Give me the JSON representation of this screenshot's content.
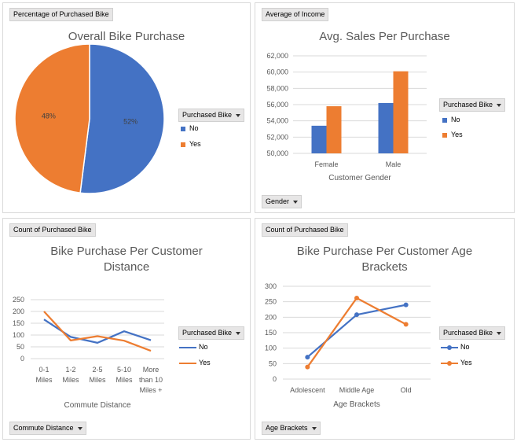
{
  "colors": {
    "no": "#4472c4",
    "yes": "#ed7d31",
    "grid": "#d9d9d9",
    "axis": "#bfbfbf",
    "text": "#595959"
  },
  "legend": {
    "header": "Purchased Bike",
    "no": "No",
    "yes": "Yes"
  },
  "panels": [
    {
      "field_button": "Percentage of Purchased Bike",
      "axis_button": ""
    },
    {
      "field_button": "Average of Income",
      "axis_button": "Gender"
    },
    {
      "field_button": "Count of Purchased Bike",
      "axis_button": "Commute Distance"
    },
    {
      "field_button": "Count of Purchased Bike",
      "axis_button": "Age Brackets"
    }
  ],
  "chart_data": [
    {
      "type": "pie",
      "title": "Overall Bike Purchase",
      "slices": [
        {
          "name": "No",
          "value": 52,
          "label": "52%"
        },
        {
          "name": "Yes",
          "value": 48,
          "label": "48%"
        }
      ],
      "legend": "right"
    },
    {
      "type": "bar",
      "title": "Avg. Sales Per Purchase",
      "xlabel": "Customer Gender",
      "categories": [
        "Female",
        "Male"
      ],
      "series": [
        {
          "name": "No",
          "values": [
            53400,
            56200
          ]
        },
        {
          "name": "Yes",
          "values": [
            55800,
            60100
          ]
        }
      ],
      "ylim": [
        50000,
        62000
      ],
      "yticks": [
        "50,000",
        "52,000",
        "54,000",
        "56,000",
        "58,000",
        "60,000",
        "62,000"
      ],
      "grid": true,
      "legend": "right"
    },
    {
      "type": "line",
      "title_lines": [
        "Bike Purchase Per Customer",
        "Distance"
      ],
      "xlabel": "Commute Distance",
      "categories": [
        [
          "0-1",
          "Miles"
        ],
        [
          "1-2",
          "Miles"
        ],
        [
          "2-5",
          "Miles"
        ],
        [
          "5-10",
          "Miles"
        ],
        [
          "More",
          "than 10",
          "Miles +"
        ]
      ],
      "series": [
        {
          "name": "No",
          "values": [
            166,
            92,
            67,
            116,
            78
          ]
        },
        {
          "name": "Yes",
          "values": [
            200,
            77,
            95,
            76,
            33
          ]
        }
      ],
      "ylim": [
        0,
        250
      ],
      "yticks": [
        "0",
        "50",
        "100",
        "150",
        "200",
        "250"
      ],
      "grid": true,
      "legend": "right"
    },
    {
      "type": "line",
      "title_lines": [
        "Bike Purchase Per Customer Age",
        "Brackets"
      ],
      "xlabel": "Age Brackets",
      "categories": [
        [
          "Adolescent"
        ],
        [
          "Middle Age"
        ],
        [
          "Old"
        ]
      ],
      "series": [
        {
          "name": "No",
          "values": [
            71,
            208,
            240
          ]
        },
        {
          "name": "Yes",
          "values": [
            39,
            262,
            177
          ]
        }
      ],
      "ylim": [
        0,
        300
      ],
      "yticks": [
        "0",
        "50",
        "100",
        "150",
        "200",
        "250",
        "300"
      ],
      "grid": true,
      "markers": true,
      "legend": "right"
    }
  ]
}
